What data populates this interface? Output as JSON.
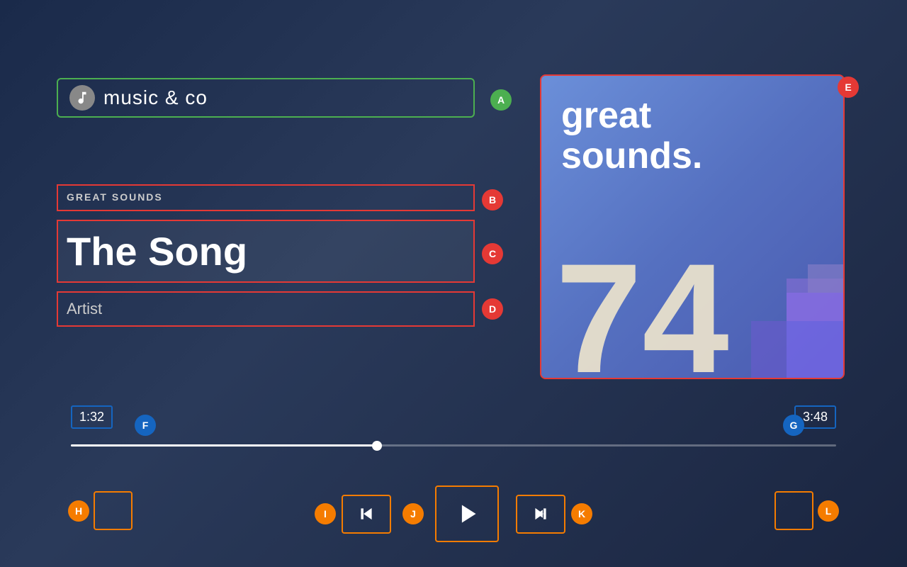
{
  "app": {
    "title": "music & co"
  },
  "album": {
    "title": "great\nsounds.",
    "number": "74",
    "genre": "GREAT SOUNDS",
    "song_title": "The Song",
    "artist": "Artist"
  },
  "player": {
    "time_current": "1:32",
    "time_total": "3:48",
    "progress_percent": 40
  },
  "badges": {
    "A": "A",
    "B": "B",
    "C": "C",
    "D": "D",
    "E": "E",
    "F": "F",
    "G": "G",
    "H": "H",
    "I": "I",
    "J": "J",
    "K": "K",
    "L": "L"
  },
  "controls": {
    "prev_label": "⏮",
    "play_label": "▶",
    "next_label": "⏭"
  }
}
